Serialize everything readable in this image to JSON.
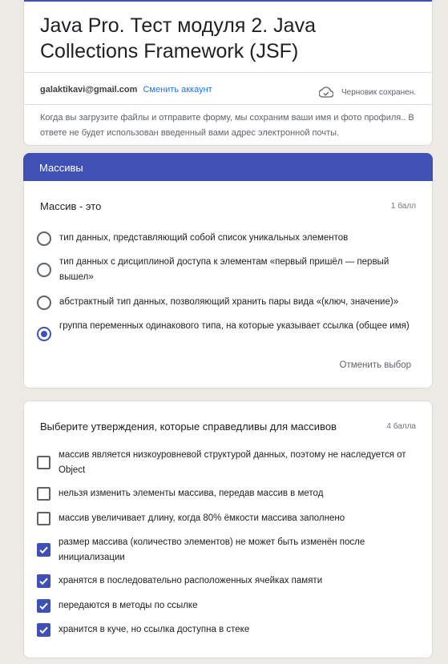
{
  "form": {
    "title": "Java Pro. Тест модуля 2. Java Collections Framework (JSF)",
    "email": "galaktikavi@gmail.com",
    "switch_account": "Сменить аккаунт",
    "draft_status": "Черновик сохранен.",
    "notice": "Когда вы загрузите файлы и отправите форму, мы сохраним ваши имя и фото профиля.. В ответе не будет использован введенный вами адрес электронной почты."
  },
  "section": {
    "title": "Массивы"
  },
  "question1": {
    "title": "Массив - это",
    "points": "1 балл",
    "options": [
      {
        "label": "тип данных, представляющий собой список уникальных элементов",
        "checked": false
      },
      {
        "label": "тип данных с дисциплиной доступа к элементам «первый пришёл — первый вышел»",
        "checked": false
      },
      {
        "label": "абстрактный тип данных, позволяющий хранить пары вида «(ключ, значение)»",
        "checked": false
      },
      {
        "label": "группа переменных одинакового типа, на которые указывает ссылка (общее имя)",
        "checked": true
      }
    ],
    "clear_label": "Отменить выбор"
  },
  "question2": {
    "title": "Выберите утверждения, которые справедливы для массивов",
    "points": "4 балла",
    "options": [
      {
        "label": "массив является низкоуровневой структурой данных, поэтому не наследуется от Object",
        "checked": false
      },
      {
        "label": "нельзя изменить элементы массива, передав массив в метод",
        "checked": false
      },
      {
        "label": "массив увеличивает длину, когда 80% ёмкости массива заполнено",
        "checked": false
      },
      {
        "label": "размер массива (количество элементов) не может быть изменён после инициализации",
        "checked": true
      },
      {
        "label": "хранятся в последовательно расположенных ячейках памяти",
        "checked": true
      },
      {
        "label": "передаются в методы по ссылке",
        "checked": true
      },
      {
        "label": "хранится в куче, но ссылка доступна в стеке",
        "checked": true
      }
    ]
  },
  "colors": {
    "accent": "#3f51b5",
    "link": "#1a73e8",
    "background": "#edeae6"
  },
  "icons": {
    "draft": "cloud-check-icon"
  }
}
